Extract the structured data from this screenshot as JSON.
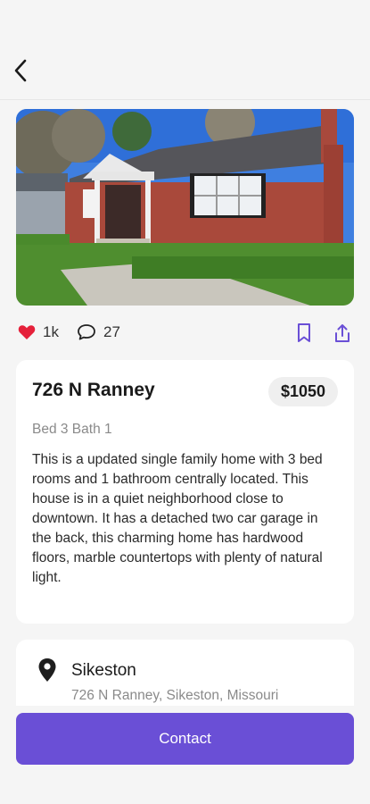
{
  "listing": {
    "title": "726 N Ranney",
    "price": "$1050",
    "specs": "Bed 3 Bath 1",
    "description": "This is a updated single family home with 3 bed rooms and 1 bathroom centrally located. This house is in a quiet neighborhood close to downtown. It has a detached two car garage in the back, this charming home has hardwood floors, marble countertops with plenty of natural light."
  },
  "engagement": {
    "likes": "1k",
    "comments": "27"
  },
  "location": {
    "city": "Sikeston",
    "address": "726 N Ranney, Sikeston, Missouri"
  },
  "actions": {
    "contact_label": "Contact"
  },
  "icons": {
    "back": "back-arrow-icon",
    "like": "heart-icon",
    "comment": "comment-icon",
    "bookmark": "bookmark-icon",
    "share": "share-icon",
    "location": "location-pin-icon"
  },
  "colors": {
    "accent": "#6a4fd6",
    "heart": "#e5203a",
    "background": "#f5f5f5"
  }
}
